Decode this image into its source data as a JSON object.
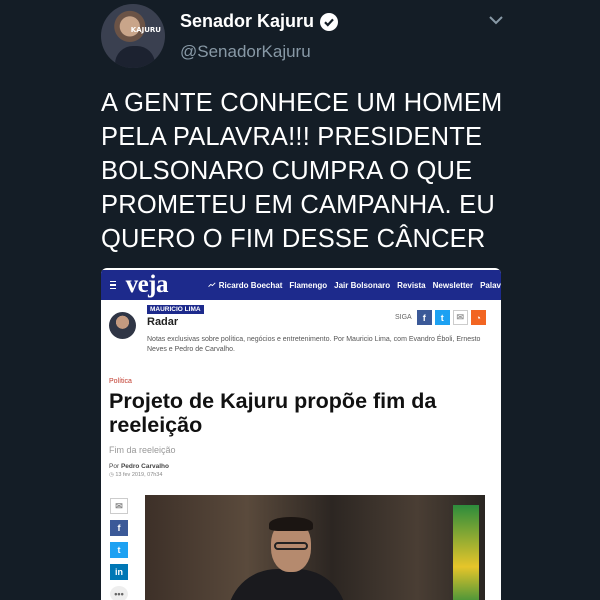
{
  "tweet": {
    "display_name": "Senador Kajuru",
    "handle": "@SenadorKajuru",
    "text": "A GENTE CONHECE UM HOMEM PELA PALAVRA!!! PRESIDENTE BOLSONARO CUMPRA O QUE PROMETEU EM CAMPANHA. EU QUERO O FIM DESSE CÂNCER",
    "avatar_text": "KAJURU",
    "icons": {
      "verified": "verified-badge-icon",
      "menu": "chevron-down-icon"
    },
    "colors": {
      "background": "#141d26",
      "secondary_text": "#8899a6"
    }
  },
  "screenshot": {
    "site": {
      "logo": "veja",
      "nav_links": [
        "Ricardo Boechat",
        "Flamengo",
        "Jair Bolsonaro",
        "Revista",
        "Newsletter",
        "Palav"
      ],
      "brand_color": "#1d2a8c"
    },
    "blog": {
      "badge": "MAURICIO LIMA",
      "name": "Radar",
      "follow_label": "SIGA",
      "description": "Notas exclusivas sobre política, negócios e entretenimento. Por Mauricio Lima, com Evandro Éboli, Ernesto Neves e Pedro de Carvalho."
    },
    "article": {
      "category": "Política",
      "headline": "Projeto de Kajuru propõe fim da reeleição",
      "subheadline": "Fim da reeleição",
      "byline_prefix": "Por",
      "author": "Pedro Carvalho",
      "date": "13 fev 2019, 07h34"
    },
    "share_icons": [
      "mail-icon",
      "facebook-icon",
      "twitter-icon",
      "linkedin-icon",
      "more-icon"
    ]
  }
}
